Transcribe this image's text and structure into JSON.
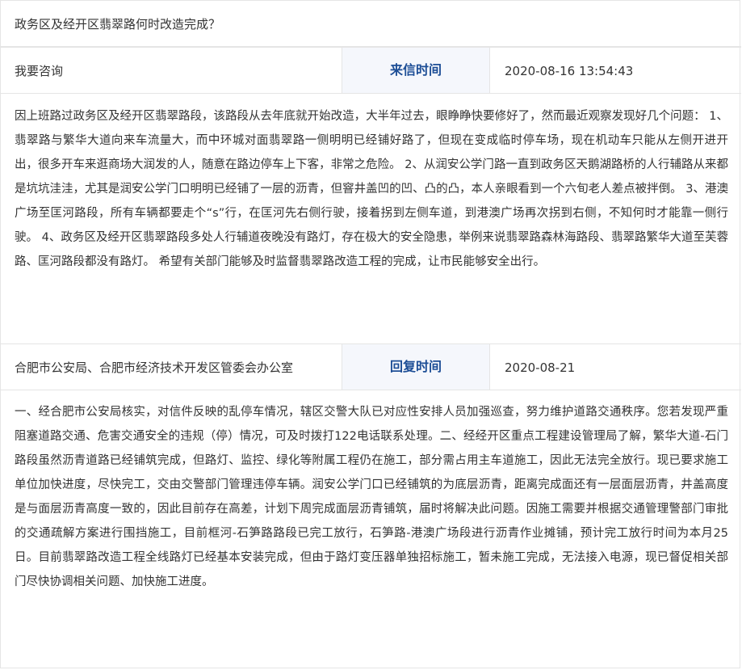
{
  "letter": {
    "title": "政务区及经开区翡翠路何时改造完成？",
    "category": "我要咨询",
    "sent_label": "来信时间",
    "sent_time": "2020-08-16 13:54:43",
    "content": "因上班路过政务区及经开区翡翠路段，该路段从去年底就开始改造，大半年过去，眼睁睁快要修好了，然而最近观察发现好几个问题： 1、翡翠路与繁华大道向来车流量大，而中环城对面翡翠路一侧明明已经铺好路了，但现在变成临时停车场，现在机动车只能从左侧开进开出，很多开车来逛商场大润发的人，随意在路边停车上下客，非常之危险。 2、从润安公学门路一直到政务区天鹅湖路桥的人行辅路从来都是坑坑洼洼，尤其是润安公学门口明明已经铺了一层的沥青，但窨井盖凹的凹、凸的凸，本人亲眼看到一个六旬老人差点被拌倒。 3、港澳广场至匡河路段，所有车辆都要走个“s”行，在匡河先右侧行驶，接着拐到左侧车道，到港澳广场再次拐到右侧，不知何时才能靠一侧行驶。 4、政务区及经开区翡翠路段多处人行辅道夜晚没有路灯，存在极大的安全隐患，举例来说翡翠路森林海路段、翡翠路繁华大道至芙蓉路、匡河路段都没有路灯。 希望有关部门能够及时监督翡翠路改造工程的完成，让市民能够安全出行。"
  },
  "reply": {
    "department": "合肥市公安局、合肥市经济技术开发区管委会办公室",
    "reply_label": "回复时间",
    "reply_time": "2020-08-21",
    "content": "一、经合肥市公安局核实，对信件反映的乱停车情况，辖区交警大队已对应性安排人员加强巡查，努力维护道路交通秩序。您若发现严重阻塞道路交通、危害交通安全的违规（停）情况，可及时拨打122电话联系处理。二、经经开区重点工程建设管理局了解，繁华大道-石门路段虽然沥青道路已经铺筑完成，但路灯、监控、绿化等附属工程仍在施工，部分需占用主车道施工，因此无法完全放行。现已要求施工单位加快进度，尽快完工，交由交警部门管理违停车辆。润安公学门口已经铺筑的为底层沥青，距离完成面还有一层面层沥青，井盖高度是与面层沥青高度一致的，因此目前存在高差，计划下周完成面层沥青铺筑，届时将解决此问题。因施工需要并根据交通管理警部门审批的交通疏解方案进行围挡施工，目前框河-石笋路路段已完工放行，石笋路-港澳广场段进行沥青作业摊铺，预计完工放行时间为本月25日。目前翡翠路改造工程全线路灯已经基本安装完成，但由于路灯变压器单独招标施工，暂未施工完成，无法接入电源，现已督促相关部门尽快协调相关问题、加快施工进度。"
  }
}
